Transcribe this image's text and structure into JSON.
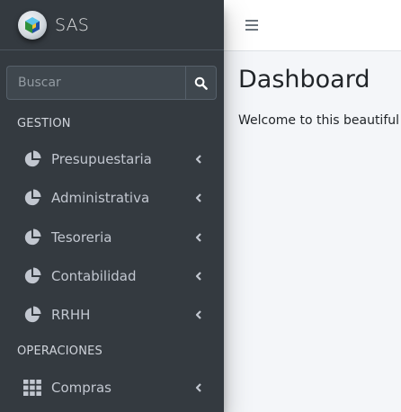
{
  "brand": {
    "name": "SAS"
  },
  "search": {
    "placeholder": "Buscar",
    "icon": "search-icon"
  },
  "sidebar": {
    "headers": [
      "GESTION",
      "OPERACIONES"
    ],
    "items": [
      {
        "label": "Presupuestaria",
        "icon": "pie-chart-icon"
      },
      {
        "label": "Administrativa",
        "icon": "pie-chart-icon"
      },
      {
        "label": "Tesoreria",
        "icon": "pie-chart-icon"
      },
      {
        "label": "Contabilidad",
        "icon": "pie-chart-icon"
      },
      {
        "label": "RRHH",
        "icon": "pie-chart-icon"
      },
      {
        "label": "Compras",
        "icon": "grid-icon"
      }
    ]
  },
  "topbar": {
    "menu_icon": "hamburger-icon"
  },
  "main": {
    "title": "Dashboard",
    "welcome": "Welcome to this beautiful"
  },
  "colors": {
    "sidebar_bg": "#343a40",
    "sidebar_text": "#c2c7d0",
    "content_bg": "#f4f6f9",
    "topbar_bg": "#ffffff"
  }
}
